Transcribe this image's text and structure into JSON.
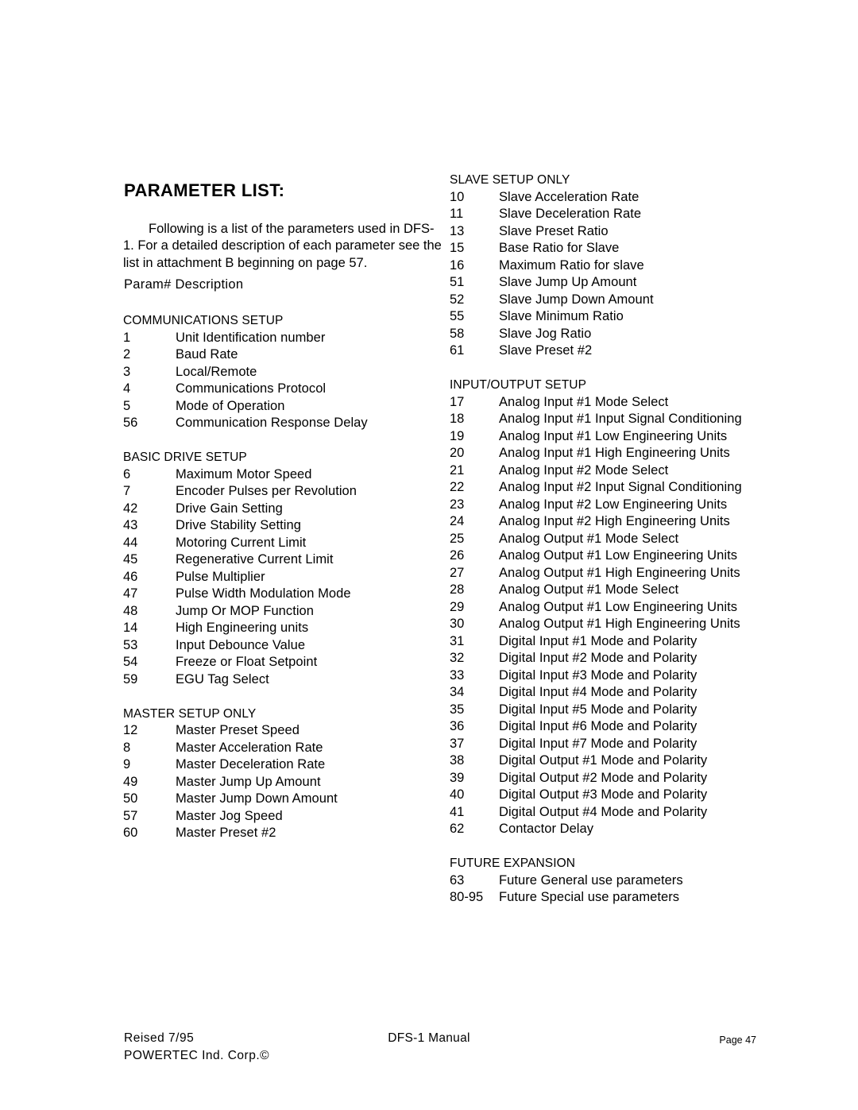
{
  "document": {
    "title": "PARAMETER LIST:",
    "intro": "Following is a list of the parameters used in DFS-1.  For a detailed description of each parameter see the list in attachment B beginning on page 57.",
    "param_heading": "Param#  Description"
  },
  "left_column": {
    "sections": [
      {
        "title": "COMMUNICATIONS SETUP",
        "rows": [
          {
            "num": "1",
            "desc": "Unit Identification number"
          },
          {
            "num": "2",
            "desc": "Baud Rate"
          },
          {
            "num": "3",
            "desc": "Local/Remote"
          },
          {
            "num": "4",
            "desc": "Communications Protocol"
          },
          {
            "num": "5",
            "desc": "Mode of Operation"
          },
          {
            "num": "56",
            "desc": "Communication Response Delay"
          }
        ]
      },
      {
        "title": "BASIC DRIVE SETUP",
        "rows": [
          {
            "num": "6",
            "desc": "Maximum Motor Speed"
          },
          {
            "num": "7",
            "desc": "Encoder Pulses per Revolution"
          },
          {
            "num": "42",
            "desc": "Drive Gain Setting"
          },
          {
            "num": "43",
            "desc": "Drive Stability Setting"
          },
          {
            "num": "44",
            "desc": "Motoring Current Limit"
          },
          {
            "num": "45",
            "desc": "Regenerative Current Limit"
          },
          {
            "num": "46",
            "desc": "Pulse Multiplier"
          },
          {
            "num": "47",
            "desc": "Pulse Width Modulation Mode"
          },
          {
            "num": "48",
            "desc": "Jump Or MOP Function"
          },
          {
            "num": "14",
            "desc": "High Engineering units"
          },
          {
            "num": "53",
            "desc": "Input Debounce Value"
          },
          {
            "num": "54",
            "desc": "Freeze or Float Setpoint"
          },
          {
            "num": "59",
            "desc": "EGU Tag Select"
          }
        ]
      },
      {
        "title": "MASTER SETUP ONLY",
        "rows": [
          {
            "num": "12",
            "desc": "Master Preset Speed"
          },
          {
            "num": "8",
            "desc": "Master Acceleration Rate"
          },
          {
            "num": "9",
            "desc": "Master Deceleration Rate"
          },
          {
            "num": "49",
            "desc": "Master Jump Up Amount"
          },
          {
            "num": "50",
            "desc": "Master Jump Down Amount"
          },
          {
            "num": "57",
            "desc": "Master Jog Speed"
          },
          {
            "num": "60",
            "desc": "Master Preset  #2"
          }
        ]
      }
    ]
  },
  "right_column": {
    "sections": [
      {
        "title": "SLAVE SETUP ONLY",
        "rows": [
          {
            "num": "10",
            "desc": "Slave Acceleration Rate"
          },
          {
            "num": "11",
            "desc": "Slave Deceleration Rate"
          },
          {
            "num": "13",
            "desc": "Slave Preset Ratio"
          },
          {
            "num": "15",
            "desc": "Base Ratio for Slave"
          },
          {
            "num": "16",
            "desc": "Maximum Ratio for slave"
          },
          {
            "num": "51",
            "desc": "Slave Jump Up Amount"
          },
          {
            "num": "52",
            "desc": "Slave Jump Down Amount"
          },
          {
            "num": "55",
            "desc": "Slave Minimum Ratio"
          },
          {
            "num": "58",
            "desc": "Slave Jog Ratio"
          },
          {
            "num": "61",
            "desc": "Slave Preset #2"
          }
        ]
      },
      {
        "title": "INPUT/OUTPUT SETUP",
        "rows": [
          {
            "num": "17",
            "desc": "Analog Input #1 Mode Select"
          },
          {
            "num": "18",
            "desc": "Analog Input #1 Input Signal Conditioning"
          },
          {
            "num": "19",
            "desc": "Analog Input #1 Low Engineering Units"
          },
          {
            "num": "20",
            "desc": "Analog Input #1 High Engineering Units"
          },
          {
            "num": "21",
            "desc": "Analog Input #2 Mode Select"
          },
          {
            "num": "22",
            "desc": "Analog Input #2 Input Signal Conditioning"
          },
          {
            "num": "23",
            "desc": "Analog Input #2 Low Engineering Units"
          },
          {
            "num": "24",
            "desc": "Analog Input #2 High Engineering Units"
          },
          {
            "num": "25",
            "desc": "Analog Output #1 Mode Select"
          },
          {
            "num": "26",
            "desc": "Analog Output #1 Low Engineering Units"
          },
          {
            "num": "27",
            "desc": "Analog Output #1 High Engineering Units"
          },
          {
            "num": "28",
            "desc": "Analog Output #1 Mode Select"
          },
          {
            "num": "29",
            "desc": "Analog Output #1 Low Engineering Units"
          },
          {
            "num": "30",
            "desc": "Analog Output #1 High Engineering Units"
          },
          {
            "num": "31",
            "desc": "Digital Input #1 Mode and Polarity"
          },
          {
            "num": "32",
            "desc": "Digital Input #2 Mode and Polarity"
          },
          {
            "num": "33",
            "desc": "Digital Input #3 Mode and Polarity"
          },
          {
            "num": "34",
            "desc": "Digital Input #4 Mode and Polarity"
          },
          {
            "num": "35",
            "desc": "Digital Input #5 Mode and Polarity"
          },
          {
            "num": "36",
            "desc": "Digital Input #6 Mode and Polarity"
          },
          {
            "num": "37",
            "desc": "Digital Input #7 Mode and Polarity"
          },
          {
            "num": "38",
            "desc": "Digital Output #1 Mode and Polarity"
          },
          {
            "num": "39",
            "desc": "Digital Output #2 Mode and Polarity"
          },
          {
            "num": "40",
            "desc": "Digital Output #3 Mode and Polarity"
          },
          {
            "num": "41",
            "desc": "Digital Output #4 Mode and Polarity"
          },
          {
            "num": "62",
            "desc": "Contactor Delay"
          }
        ]
      },
      {
        "title": "FUTURE EXPANSION",
        "rows": [
          {
            "num": "63",
            "desc": "Future General use parameters"
          },
          {
            "num": "80-95",
            "desc": "Future Special use parameters"
          }
        ]
      }
    ]
  },
  "footer": {
    "revised": "Reised 7/95",
    "company": "POWERTEC Ind. Corp.©",
    "manual": "DFS-1 Manual",
    "page": "Page 47"
  }
}
